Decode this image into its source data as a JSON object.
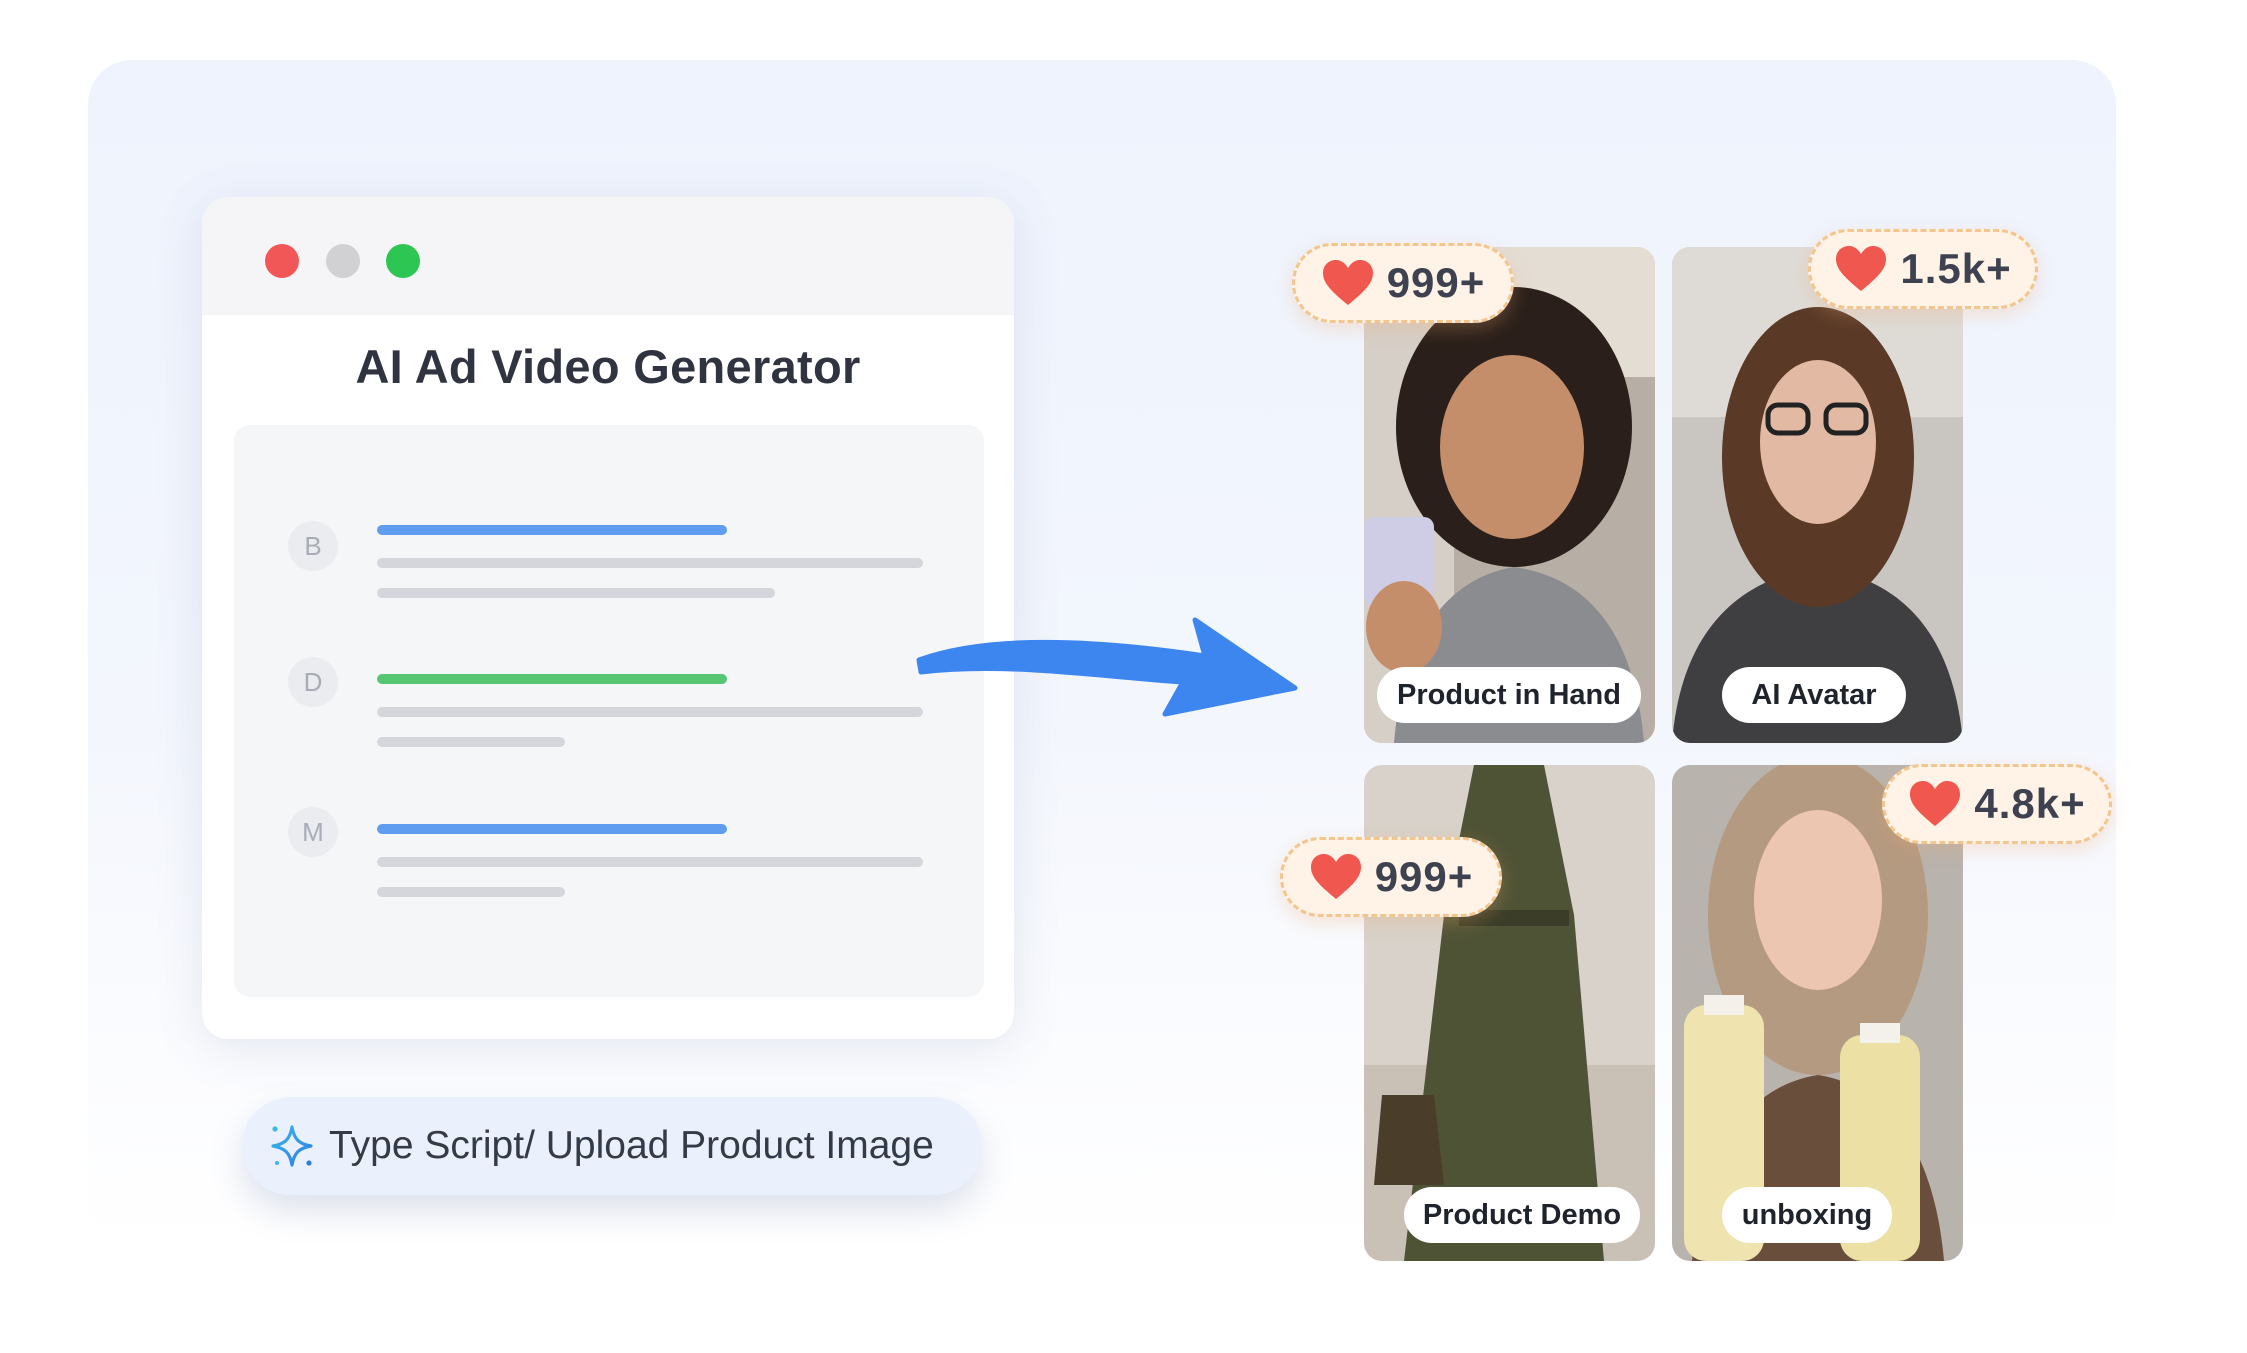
{
  "window": {
    "title": "AI Ad Video Generator",
    "rows": [
      {
        "initial": "B",
        "accent": "#5f9df0"
      },
      {
        "initial": "D",
        "accent": "#56c674"
      },
      {
        "initial": "M",
        "accent": "#5f9df0"
      }
    ]
  },
  "input_pill": {
    "icon": "sparkle-icon",
    "text": "Type Script/ Upload Product Image"
  },
  "videos": [
    {
      "label": "Product in Hand",
      "likes": "999+"
    },
    {
      "label": "AI Avatar",
      "likes": "1.5k+"
    },
    {
      "label": "Product Demo",
      "likes": "999+"
    },
    {
      "label": "unboxing",
      "likes": "4.8k+"
    }
  ],
  "colors": {
    "arrow": "#3d86ef",
    "heart": "#f0574f",
    "traffic_red": "#f25757",
    "traffic_gray": "#d1d1d4",
    "traffic_green": "#2ec653"
  }
}
